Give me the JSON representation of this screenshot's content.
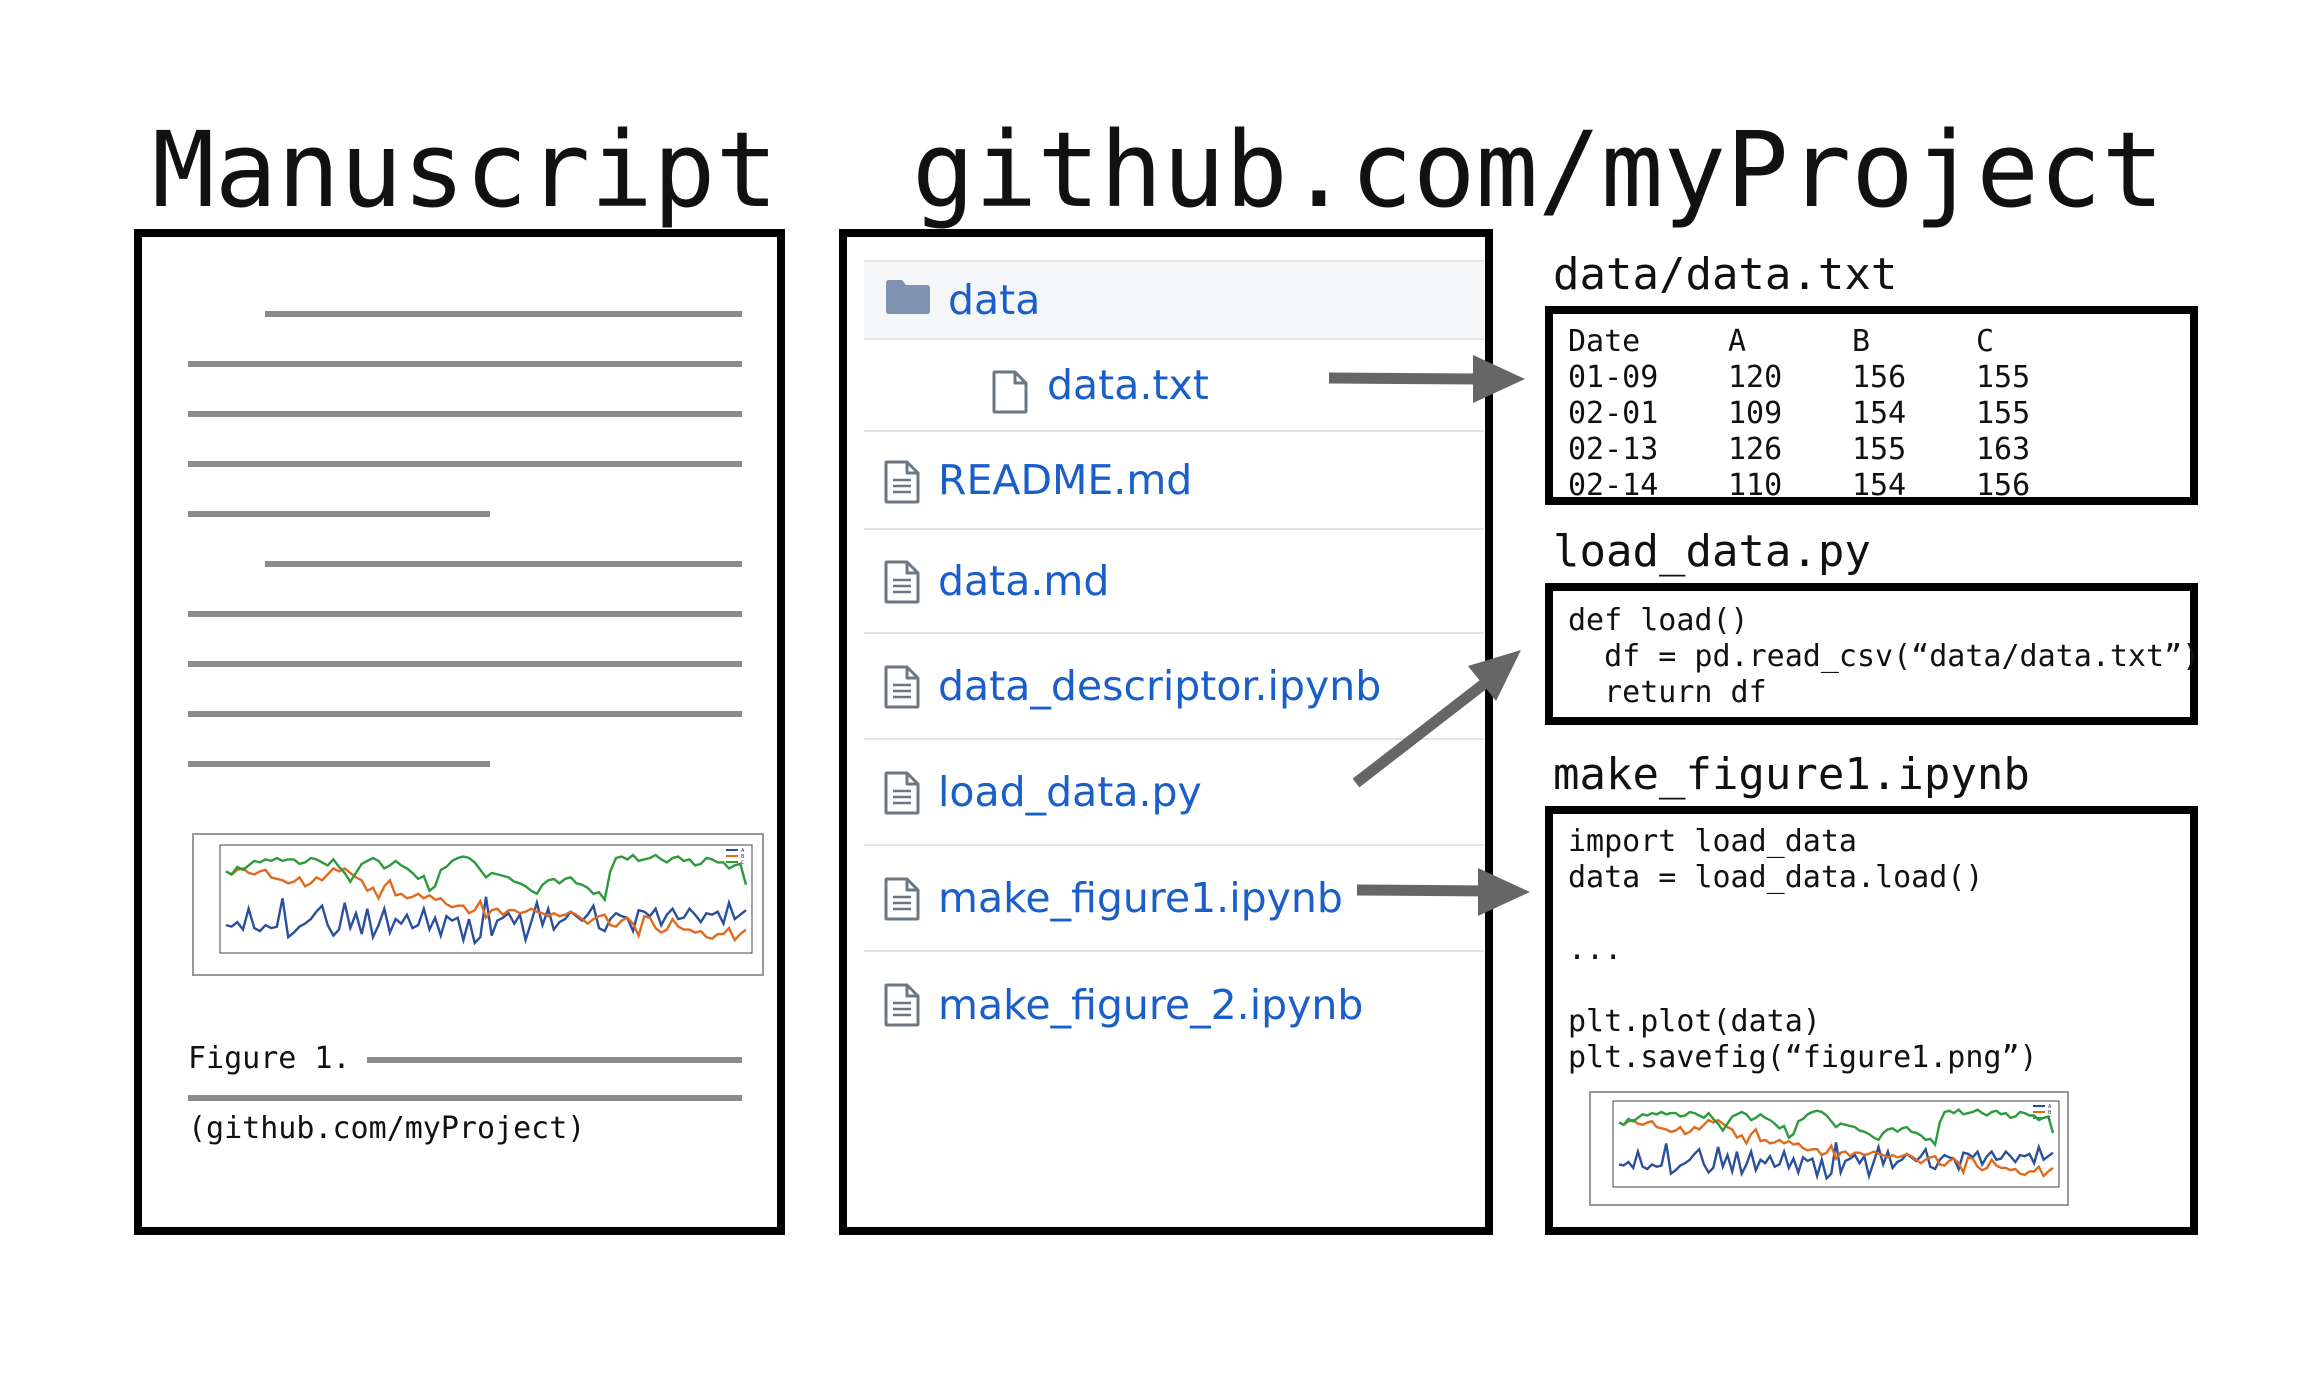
{
  "titles": {
    "manuscript": "Manuscript",
    "repo": "github.com/myProject"
  },
  "manuscript": {
    "figure_caption": "Figure 1.",
    "repo_reference": "(github.com/myProject)"
  },
  "file_browser": {
    "folder": {
      "name": "data",
      "icon": "folder-icon"
    },
    "items": [
      {
        "name": "data.txt",
        "icon": "file-icon",
        "nested": true
      },
      {
        "name": "README.md",
        "icon": "file-text-icon"
      },
      {
        "name": "data.md",
        "icon": "file-text-icon"
      },
      {
        "name": "data_descriptor.ipynb",
        "icon": "file-text-icon"
      },
      {
        "name": "load_data.py",
        "icon": "file-text-icon"
      },
      {
        "name": "make_figure1.ipynb",
        "icon": "file-text-icon"
      },
      {
        "name": "make_figure_2.ipynb",
        "icon": "file-text-icon"
      }
    ]
  },
  "panels": {
    "data_txt": {
      "label": "data/data.txt",
      "header": [
        "Date",
        "A",
        "B",
        "C"
      ],
      "rows": [
        [
          "01-09",
          "120",
          "156",
          "155"
        ],
        [
          "02-01",
          "109",
          "154",
          "155"
        ],
        [
          "02-13",
          "126",
          "155",
          "163"
        ],
        [
          "02-14",
          "110",
          "154",
          "156"
        ]
      ]
    },
    "load_data": {
      "label": "load_data.py",
      "code": "def load()\n  df = pd.read_csv(“data/data.txt”)\n  return df"
    },
    "make_figure1": {
      "label": "make_figure1.ipynb",
      "code": "import load_data\ndata = load_data.load()\n\n...\n\nplt.plot(data)\nplt.savefig(“figure1.png”)"
    }
  },
  "colors": {
    "link": "#1a5fc9",
    "text_line": "#8c8c8c",
    "arrow": "#666666",
    "series_A": "#2a4f9c",
    "series_B": "#e06a1e",
    "series_C": "#2d9a3c",
    "folder": "#7f93b0"
  },
  "chart_data": {
    "type": "line",
    "legend_position": "top-right",
    "series": [
      {
        "name": "A",
        "values": [
          120,
          119,
          122,
          117,
          131,
          118,
          116,
          120,
          118,
          119,
          138,
          112,
          115,
          119,
          121,
          124,
          129,
          133,
          120,
          113,
          117,
          135,
          118,
          128,
          114,
          131,
          112,
          120,
          131,
          115,
          124,
          121,
          127,
          118,
          120,
          131,
          117,
          125,
          113,
          126,
          123,
          125,
          110,
          124,
          108,
          112,
          139,
          113,
          123,
          125,
          128,
          121,
          127,
          110,
          122,
          135,
          120,
          131,
          117,
          122,
          124,
          129,
          126,
          123,
          127,
          133,
          118,
          116,
          124,
          128,
          126,
          125,
          116,
          130,
          129,
          126,
          131,
          120,
          127,
          131,
          124,
          125,
          131,
          127,
          122,
          128,
          127,
          129,
          121,
          135,
          124,
          127,
          130
        ]
      },
      {
        "name": "B",
        "values": [
          156,
          154,
          157,
          158,
          155,
          154,
          156,
          157,
          152,
          151,
          150,
          148,
          149,
          152,
          146,
          148,
          152,
          150,
          154,
          158,
          156,
          158,
          155,
          152,
          150,
          143,
          145,
          138,
          146,
          150,
          140,
          141,
          138,
          139,
          141,
          138,
          140,
          137,
          138,
          134,
          132,
          133,
          133,
          128,
          130,
          136,
          125,
          130,
          131,
          127,
          130,
          130,
          128,
          129,
          131,
          129,
          128,
          126,
          128,
          126,
          127,
          129,
          127,
          124,
          121,
          124,
          126,
          127,
          120,
          119,
          123,
          125,
          121,
          113,
          126,
          125,
          118,
          115,
          117,
          124,
          119,
          117,
          117,
          115,
          116,
          112,
          111,
          114,
          114,
          118,
          110,
          114,
          117
        ]
      },
      {
        "name": "C",
        "values": [
          156,
          154,
          159,
          157,
          160,
          163,
          162,
          164,
          163,
          165,
          163,
          164,
          164,
          161,
          162,
          165,
          164,
          162,
          160,
          164,
          159,
          155,
          149,
          155,
          161,
          163,
          165,
          163,
          158,
          160,
          163,
          160,
          158,
          155,
          151,
          153,
          143,
          146,
          157,
          159,
          163,
          165,
          166,
          165,
          162,
          157,
          152,
          155,
          154,
          153,
          152,
          149,
          148,
          146,
          143,
          141,
          147,
          150,
          151,
          148,
          151,
          152,
          148,
          147,
          145,
          141,
          142,
          137,
          156,
          165,
          166,
          164,
          167,
          163,
          164,
          165,
          167,
          164,
          162,
          165,
          166,
          163,
          164,
          160,
          161,
          165,
          164,
          162,
          162,
          158,
          160,
          161,
          147
        ]
      }
    ]
  }
}
